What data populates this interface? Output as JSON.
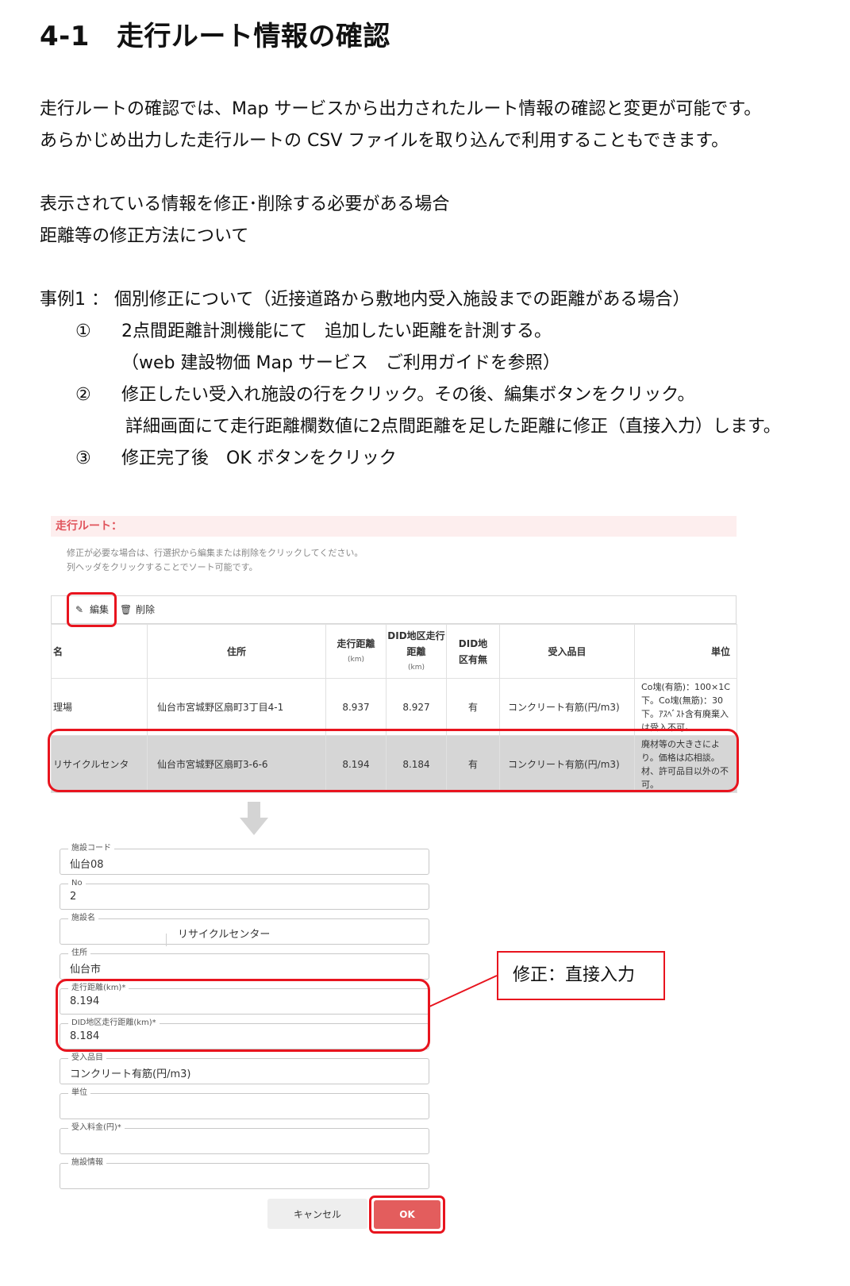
{
  "heading": {
    "number": "4-1",
    "title": "走行ルート情報の確認"
  },
  "intro": [
    "走行ルートの確認では、Map サービスから出力されたルート情報の確認と変更が可能です。",
    "あらかじめ出力した走行ルートの CSV ファイルを取り込んで利用することもできます。"
  ],
  "notes": [
    "表示されている情報を修正･削除する必要がある場合",
    "距離等の修正方法について"
  ],
  "example": {
    "title": "事例1 ： 個別修正について（近接道路から敷地内受入施設までの距離がある場合）",
    "steps": [
      {
        "mark": "①",
        "text": "2点間距離計測機能にて　追加したい距離を計測する。"
      },
      {
        "mark": "",
        "text": "（web 建設物価 Map サービス　ご利用ガイドを参照）"
      },
      {
        "mark": "②",
        "text": "修正したい受入れ施設の行をクリック。その後、編集ボタンをクリック。"
      },
      {
        "mark": "",
        "text": "詳細画面にて走行距離欄数値に2点間距離を足した距離に修正（直接入力）します。"
      },
      {
        "mark": "③",
        "text": "修正完了後　OK ボタンをクリック"
      }
    ]
  },
  "panel": {
    "title": "走行ルート：",
    "note_lines": [
      "修正が必要な場合は、行選択から編集または削除をクリックしてください。",
      "列ヘッダをクリックすることでソート可能です。"
    ],
    "edit_label": "編集",
    "delete_label": "削除",
    "columns": {
      "name": "名",
      "address": "住所",
      "distance": "走行距離",
      "distance_unit": "(km)",
      "did_distance": "DID地区走行距離",
      "did_distance_unit": "(km)",
      "did_flag": "DID地区有無",
      "item": "受入品目",
      "unit": "単位"
    },
    "rows": [
      {
        "name": "理場",
        "address": "仙台市宮城野区扇町3丁目4-1",
        "distance": "8.937",
        "did_distance": "8.927",
        "did_flag": "有",
        "item": "コンクリート有筋(円/m3)",
        "unit": "Co塊(有筋)：100×1C下。Co塊(無筋)：30下。ｱｽﾍﾞｽﾄ含有廃棄入は受入不可。"
      },
      {
        "name": "リサイクルセンタ",
        "address": "仙台市宮城野区扇町3-6-6",
        "distance": "8.194",
        "did_distance": "8.184",
        "did_flag": "有",
        "item": "コンクリート有筋(円/m3)",
        "unit": "廃材等の大きさによ り。価格は応相談。材、許可品目以外の不可。"
      }
    ]
  },
  "form": {
    "facility_code": {
      "label": "施設コード",
      "value": "仙台08"
    },
    "no": {
      "label": "No",
      "value": "2"
    },
    "facility_name": {
      "label": "施設名",
      "value": "リサイクルセンター"
    },
    "address": {
      "label": "住所",
      "value": "仙台市"
    },
    "distance": {
      "label": "走行距離(km)*",
      "value": "8.194"
    },
    "did_distance": {
      "label": "DID地区走行距離(km)*",
      "value": "8.184"
    },
    "item": {
      "label": "受入品目",
      "value": "コンクリート有筋(円/m3)"
    },
    "unit": {
      "label": "単位",
      "value": ""
    },
    "fee": {
      "label": "受入料金(円)*",
      "value": ""
    },
    "info": {
      "label": "施設情報",
      "value": ""
    },
    "cancel_label": "キャンセル",
    "ok_label": "OK"
  },
  "callout": {
    "text": "修正：直接入力"
  },
  "colors": {
    "highlight": "#e8141e",
    "ok_button": "#e35d5d",
    "panel_title": "#e0535b",
    "selected_row": "#d6d6d6"
  }
}
